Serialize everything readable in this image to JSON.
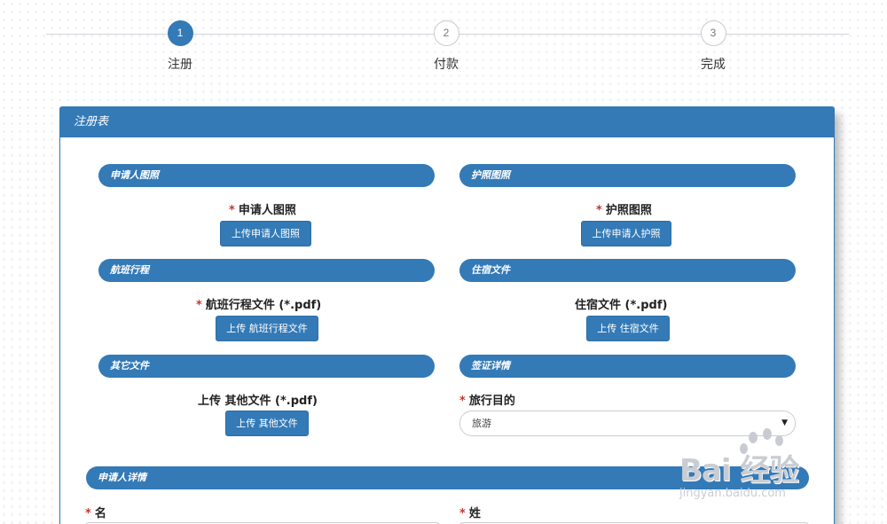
{
  "stepper": {
    "steps": [
      {
        "num": "1",
        "label": "注册",
        "active": true
      },
      {
        "num": "2",
        "label": "付款",
        "active": false
      },
      {
        "num": "3",
        "label": "完成",
        "active": false
      }
    ]
  },
  "panel": {
    "title": "注册表",
    "sections": {
      "applicant_photo": {
        "title": "申请人图照",
        "label": "申请人图照",
        "button": "上传申请人图照"
      },
      "passport_photo": {
        "title": "护照图照",
        "label": "护照图照",
        "button": "上传申请人护照"
      },
      "flight_itinerary": {
        "title": "航班行程",
        "label": "航班行程文件 (*.pdf)",
        "button": "上传 航班行程文件"
      },
      "accommodation": {
        "title": "住宿文件",
        "label": "住宿文件 (*.pdf)",
        "button": "上传 住宿文件"
      },
      "other_files": {
        "title": "其它文件",
        "label": "上传  其他文件 (*.pdf)",
        "button": "上传 其他文件"
      },
      "visa_details": {
        "title": "签证详情",
        "label": "旅行目的",
        "select_value": "旅游",
        "caret": "▼"
      },
      "applicant_details": {
        "title": "申请人详情",
        "first_name_label": "名",
        "last_name_label": "姓"
      }
    }
  },
  "required_mark": "*",
  "watermark": {
    "text": "Bai 经验",
    "url": "jingyan.baidu.com"
  },
  "colors": {
    "primary": "#337ab7",
    "required": "#c0392b"
  }
}
